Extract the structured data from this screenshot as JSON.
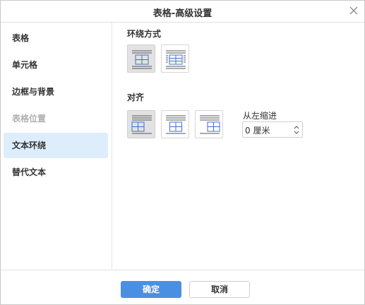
{
  "dialog": {
    "title": "表格-高级设置"
  },
  "sidebar": {
    "items": [
      {
        "label": "表格",
        "state": "normal"
      },
      {
        "label": "单元格",
        "state": "normal"
      },
      {
        "label": "边框与背景",
        "state": "normal"
      },
      {
        "label": "表格位置",
        "state": "disabled"
      },
      {
        "label": "文本环绕",
        "state": "active"
      },
      {
        "label": "替代文本",
        "state": "normal"
      }
    ]
  },
  "wrap": {
    "label": "环绕方式",
    "options": [
      {
        "icon": "wrap-inline-icon",
        "selected": true
      },
      {
        "icon": "wrap-flow-icon",
        "selected": false
      }
    ]
  },
  "align": {
    "label": "对齐",
    "options": [
      {
        "icon": "align-left-icon",
        "selected": true
      },
      {
        "icon": "align-center-icon",
        "selected": false
      },
      {
        "icon": "align-right-icon",
        "selected": false
      }
    ],
    "indent_label": "从左缩进",
    "indent_value": "0 厘米"
  },
  "footer": {
    "ok_label": "确定",
    "cancel_label": "取消"
  },
  "colors": {
    "accent": "#4a90e2",
    "active_nav_bg": "#deedfb",
    "icon_blue": "#3f6fd6",
    "selected_option_bg": "#e2e2e2"
  }
}
